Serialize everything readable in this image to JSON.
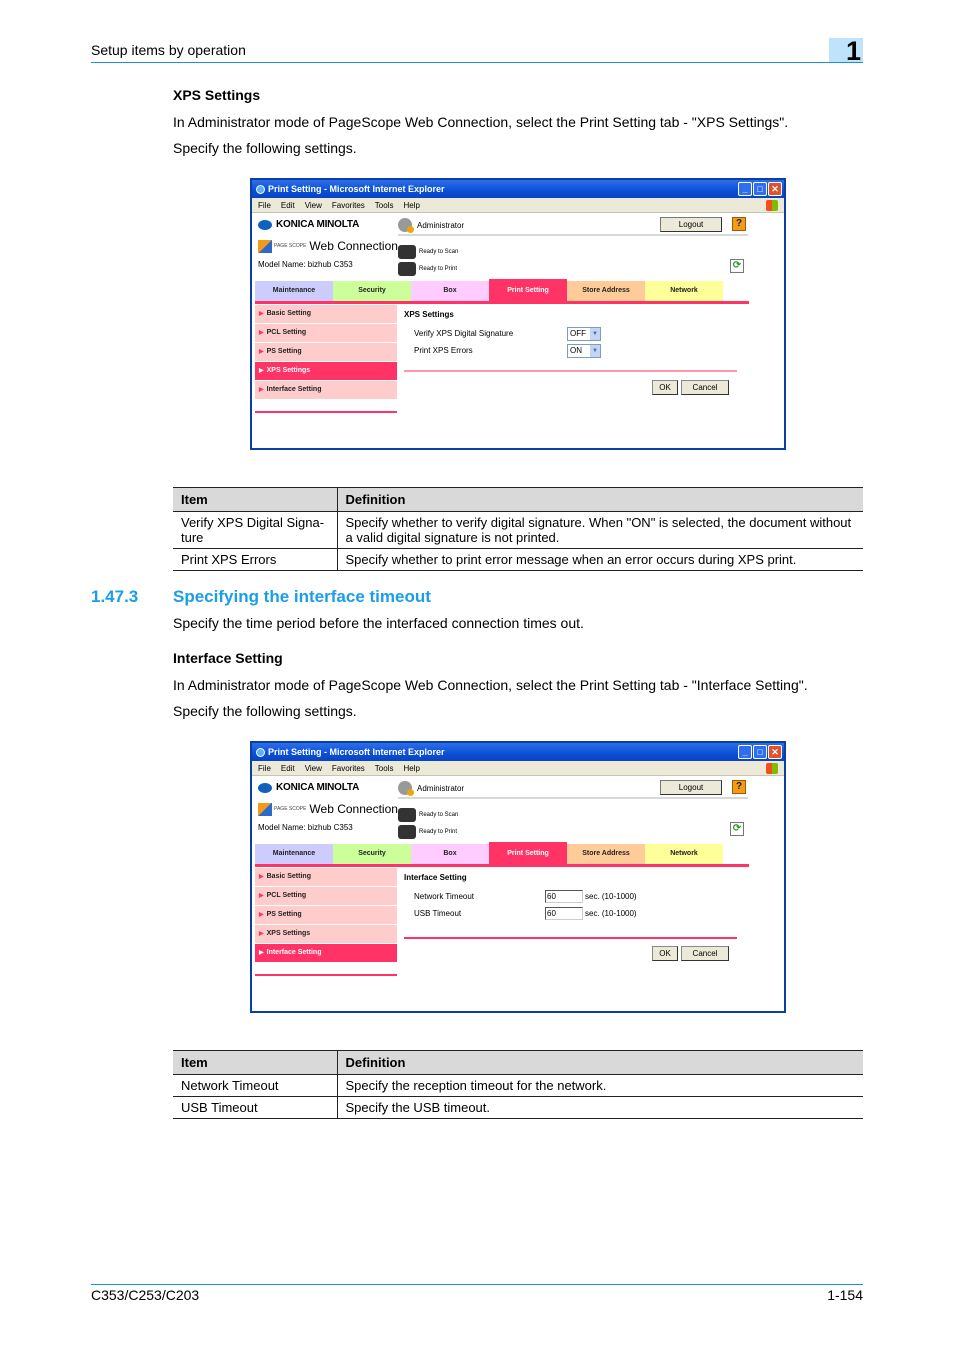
{
  "header": {
    "running_title": "Setup items by operation",
    "chapter": "1"
  },
  "xps_section": {
    "heading": "XPS Settings",
    "intro": "In Administrator mode of PageScope Web Connection, select the Print Setting tab - \"XPS Settings\".",
    "specify": "Specify the following settings."
  },
  "browser": {
    "title": "Print Setting - Microsoft Internet Explorer",
    "menu": [
      "File",
      "Edit",
      "View",
      "Favorites",
      "Tools",
      "Help"
    ],
    "brand": "KONICA MINOLTA",
    "product_small": "PAGE SCOPE",
    "product": "Web Connection",
    "model": "Model Name: bizhub C353",
    "user": "Administrator",
    "logout": "Logout",
    "help": "?",
    "refresh": "⟳",
    "scan_status": "Ready to Scan",
    "print_status": "Ready to Print",
    "tabs": [
      {
        "label": "Maintenance",
        "color": "#ccccff"
      },
      {
        "label": "Security",
        "color": "#ccff99"
      },
      {
        "label": "Box",
        "color": "#ffccff"
      },
      {
        "label": "Print Setting",
        "color": "#ff3366"
      },
      {
        "label": "Store Address",
        "color": "#ffcc99"
      },
      {
        "label": "Network",
        "color": "#ffff99"
      }
    ],
    "side_menu": [
      "Basic Setting",
      "PCL Setting",
      "PS Setting",
      "XPS Settings",
      "Interface Setting"
    ],
    "ok": "OK",
    "cancel": "Cancel"
  },
  "xps_panel": {
    "title": "XPS Settings",
    "fields": [
      {
        "label": "Verify XPS Digital Signature",
        "value": "OFF"
      },
      {
        "label": "Print XPS Errors",
        "value": "ON"
      }
    ]
  },
  "xps_table": {
    "headers": [
      "Item",
      "Definition"
    ],
    "rows": [
      [
        "Verify XPS Digital Signa-ture",
        "Specify whether to verify digital signature. When \"ON\" is selected, the document without a valid digital signature is not printed."
      ],
      [
        "Print XPS Errors",
        "Specify whether to print error message when an error occurs during XPS print."
      ]
    ]
  },
  "section_1473": {
    "number": "1.47.3",
    "title": "Specifying the interface timeout",
    "desc": "Specify the time period before the interfaced connection times out.",
    "heading": "Interface Setting",
    "intro": "In Administrator mode of PageScope Web Connection, select the Print Setting tab - \"Interface Setting\".",
    "specify": "Specify the following settings."
  },
  "iface_panel": {
    "title": "Interface Setting",
    "fields": [
      {
        "label": "Network Timeout",
        "value": "60",
        "unit": "sec. (10-1000)"
      },
      {
        "label": "USB Timeout",
        "value": "60",
        "unit": "sec. (10-1000)"
      }
    ]
  },
  "iface_table": {
    "headers": [
      "Item",
      "Definition"
    ],
    "rows": [
      [
        "Network Timeout",
        "Specify the reception timeout for the network."
      ],
      [
        "USB Timeout",
        "Specify the USB timeout."
      ]
    ]
  },
  "footer": {
    "model": "C353/C253/C203",
    "page": "1-154"
  }
}
